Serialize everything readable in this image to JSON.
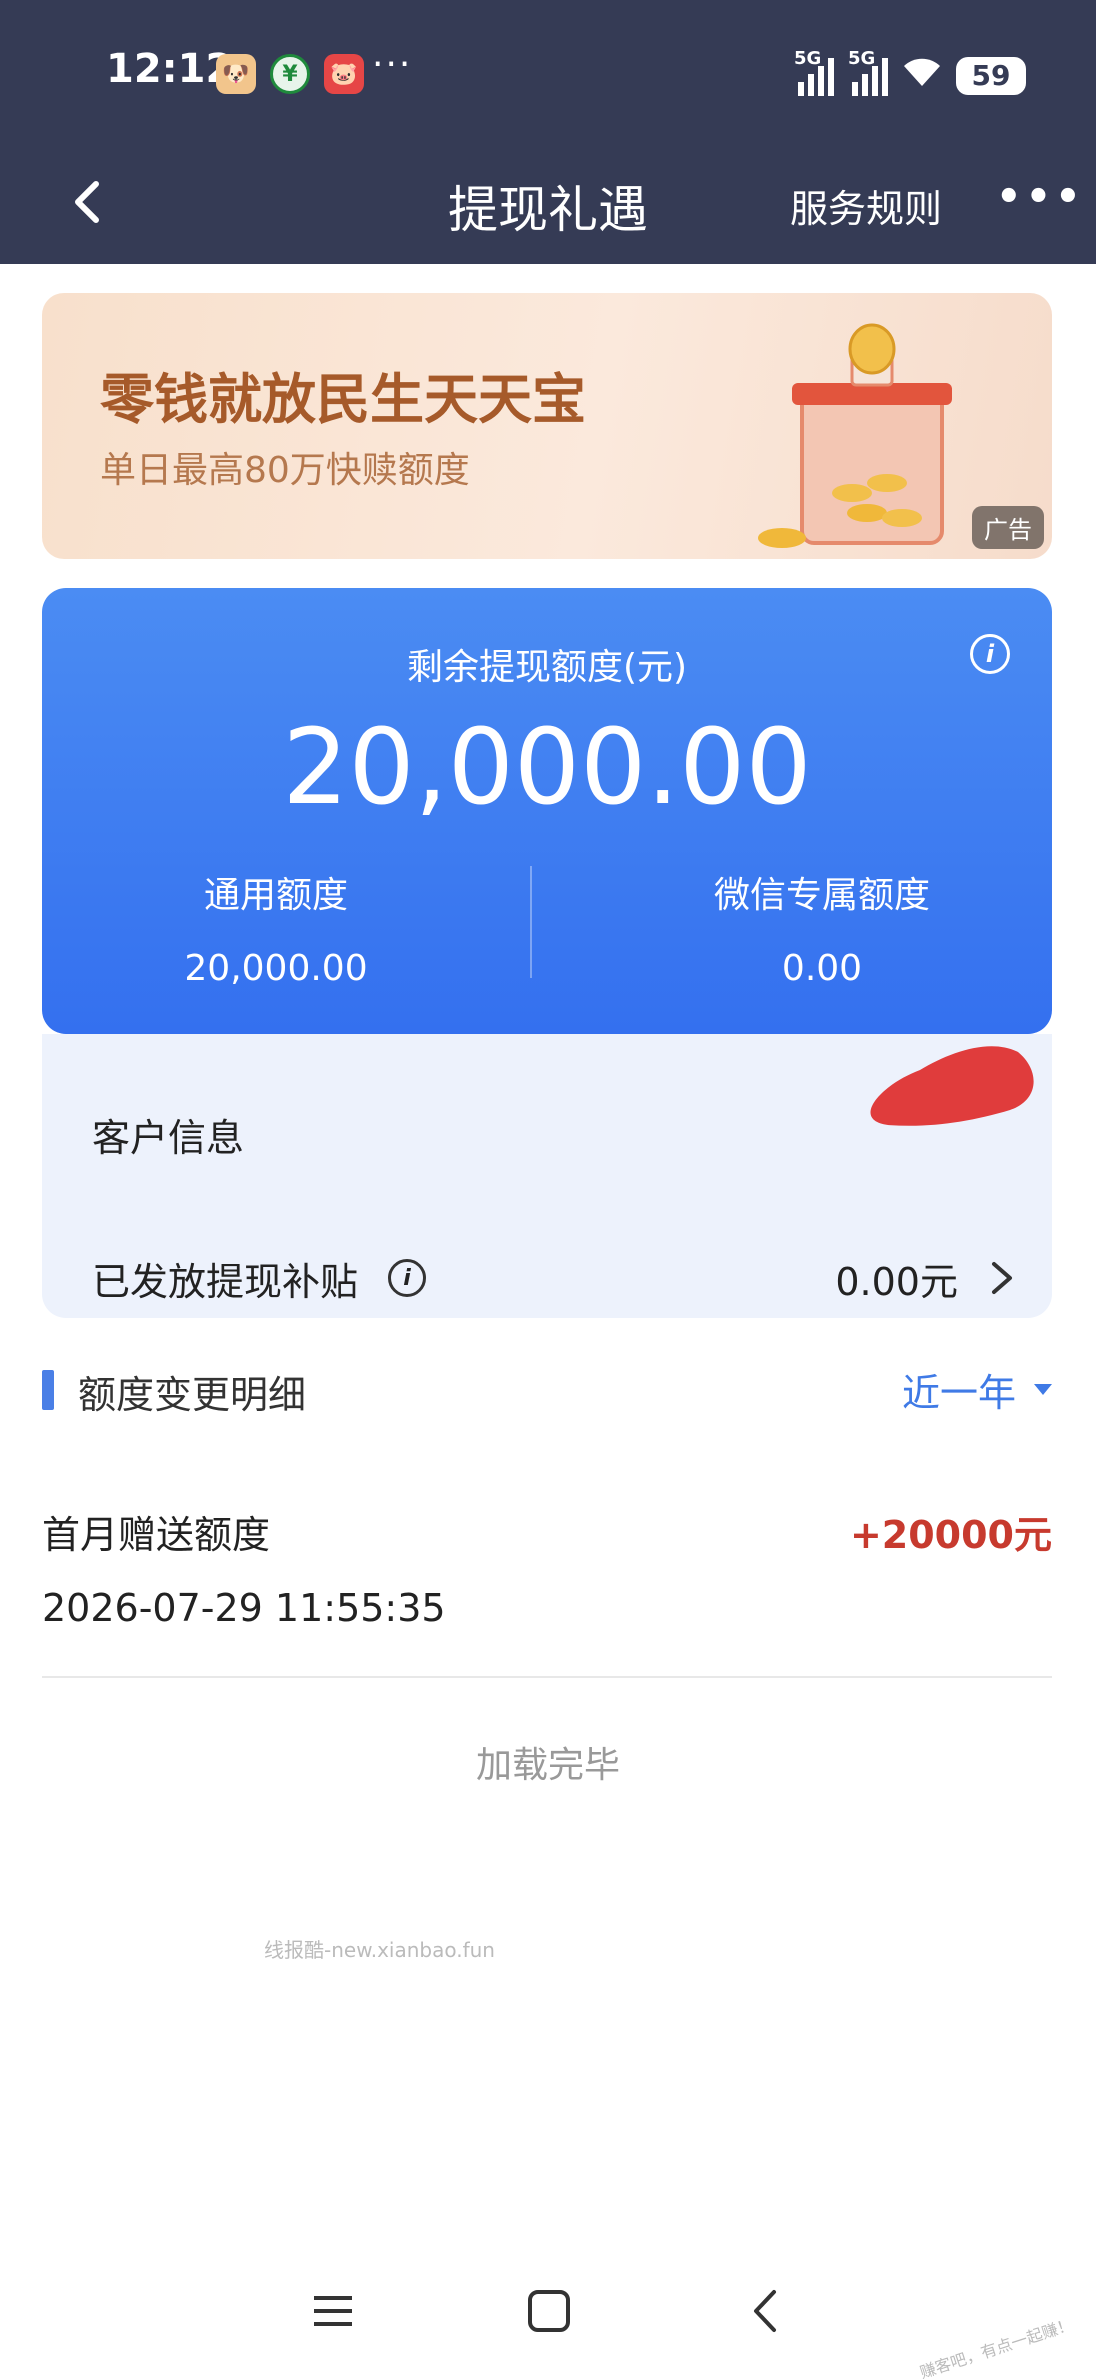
{
  "status_bar": {
    "time": "12:12",
    "more": "···",
    "signal_1": "5G",
    "signal_2": "5G",
    "battery": "59"
  },
  "header": {
    "title": "提现礼遇",
    "rules_label": "服务规则",
    "more_label": "•••"
  },
  "ad": {
    "title": "零钱就放民生天天宝",
    "subtitle": "单日最高80万快赎额度",
    "badge": "广告"
  },
  "quota": {
    "label": "剩余提现额度(元)",
    "amount": "20,000.00",
    "general_label": "通用额度",
    "general_value": "20,000.00",
    "wechat_label": "微信专属额度",
    "wechat_value": "0.00"
  },
  "info": {
    "customer_label": "客户信息",
    "subsidy_label": "已发放提现补贴",
    "subsidy_value": "0.00元"
  },
  "section": {
    "title": "额度变更明细",
    "filter": "近一年"
  },
  "records": [
    {
      "name": "首月赠送额度",
      "amount": "+20000元",
      "time": "2026-07-29 11:55:35"
    }
  ],
  "footer": {
    "loaded": "加载完毕",
    "watermark": "线报酷-new.xianbao.fun",
    "corner_mark": "赚客吧，有点一起赚！"
  },
  "colors": {
    "topbar": "#353b55",
    "card_blue": "#3f7cf1",
    "info_bg": "#edf2fc",
    "accent_blue": "#3f7ae6",
    "amount_red": "#c73a2e"
  }
}
